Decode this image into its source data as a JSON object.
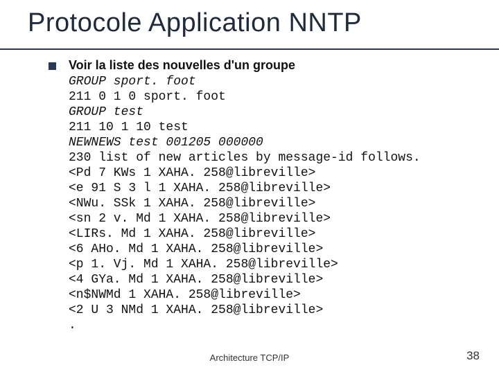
{
  "title": "Protocole Application NNTP",
  "heading": "Voir la liste des nouvelles d'un groupe",
  "lines": [
    {
      "text": "GROUP sport. foot",
      "cmd": true
    },
    {
      "text": "211 0 1 0 sport. foot",
      "cmd": false
    },
    {
      "text": "GROUP test",
      "cmd": true
    },
    {
      "text": "211 10 1 10 test",
      "cmd": false
    },
    {
      "text": "NEWNEWS test 001205 000000",
      "cmd": true
    },
    {
      "text": "230 list of new articles by message-id follows.",
      "cmd": false
    },
    {
      "text": "<Pd 7 KWs 1 XAHA. 258@libreville>",
      "cmd": false
    },
    {
      "text": "<e 91 S 3 l 1 XAHA. 258@libreville>",
      "cmd": false
    },
    {
      "text": "<NWu. SSk 1 XAHA. 258@libreville>",
      "cmd": false
    },
    {
      "text": "<sn 2 v. Md 1 XAHA. 258@libreville>",
      "cmd": false
    },
    {
      "text": "<LIRs. Md 1 XAHA. 258@libreville>",
      "cmd": false
    },
    {
      "text": "<6 AHo. Md 1 XAHA. 258@libreville>",
      "cmd": false
    },
    {
      "text": "<p 1. Vj. Md 1 XAHA. 258@libreville>",
      "cmd": false
    },
    {
      "text": "<4 GYa. Md 1 XAHA. 258@libreville>",
      "cmd": false
    },
    {
      "text": "<n$NWMd 1 XAHA. 258@libreville>",
      "cmd": false
    },
    {
      "text": "<2 U 3 NMd 1 XAHA. 258@libreville>",
      "cmd": false
    },
    {
      "text": ".",
      "cmd": false
    }
  ],
  "footer": {
    "center": "Architecture TCP/IP",
    "page": "38"
  }
}
